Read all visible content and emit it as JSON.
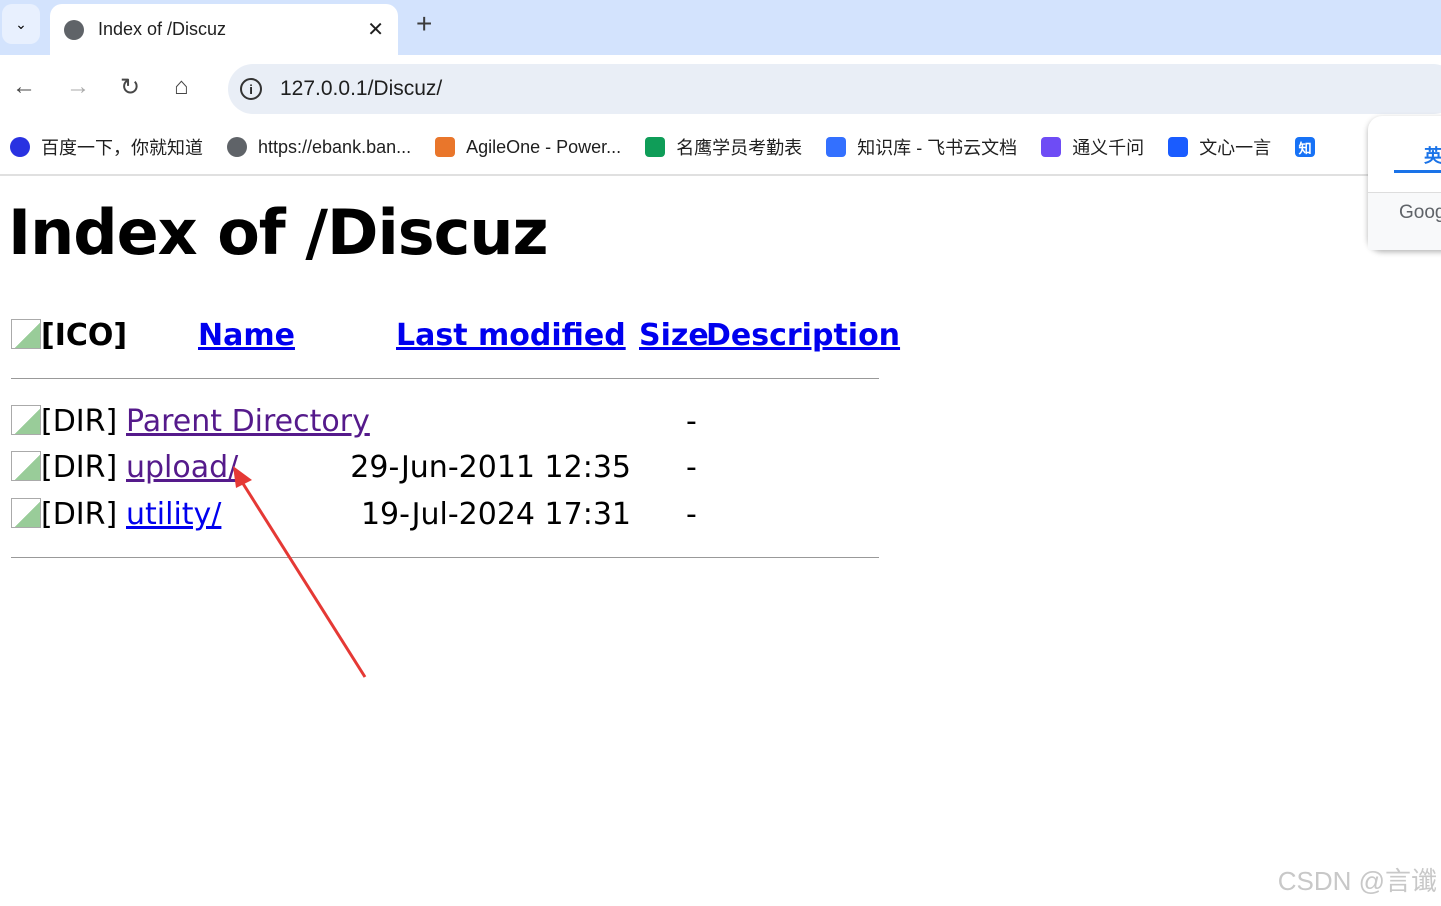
{
  "browser": {
    "tab_title": "Index of /Discuz",
    "url": "127.0.0.1/Discuz/",
    "bookmarks": [
      {
        "label": "百度一下，你就知道",
        "icon": "baidu-icon",
        "color": "#2932e1"
      },
      {
        "label": "https://ebank.ban...",
        "icon": "globe-icon",
        "color": "#5f6368"
      },
      {
        "label": "AgileOne - Power...",
        "icon": "xampp-icon",
        "color": "#e9762b"
      },
      {
        "label": "名鹰学员考勤表",
        "icon": "sheet-icon",
        "color": "#0f9d58"
      },
      {
        "label": "知识库 - 飞书云文档",
        "icon": "feishu-icon",
        "color": "#3370ff"
      },
      {
        "label": "通义千问",
        "icon": "tongyi-icon",
        "color": "#6e4cf5"
      },
      {
        "label": "文心一言",
        "icon": "wenxin-icon",
        "color": "#1a5cff"
      },
      {
        "label": "",
        "icon": "zhihu-icon",
        "color": "#1772f6",
        "glyph": "知"
      }
    ],
    "translate_popup": {
      "lang": "英",
      "provider": "Goog"
    }
  },
  "page": {
    "title": "Index of /Discuz",
    "headers": {
      "ico": "[ICO]",
      "name": "Name",
      "modified": "Last modified",
      "size": "Size",
      "desc": "Description"
    },
    "rows": [
      {
        "type": "[DIR]",
        "name": "Parent Directory",
        "modified": "",
        "size": "-"
      },
      {
        "type": "[DIR]",
        "name": "upload/",
        "modified": "29-Jun-2011 12:35",
        "size": "-"
      },
      {
        "type": "[DIR]",
        "name": "utility/",
        "modified": "19-Jul-2024 17:31",
        "size": "-"
      }
    ]
  },
  "watermark": "CSDN @言谶",
  "colors": {
    "link": "#0000ee",
    "visited": "#551a8b",
    "arrow": "#e53935"
  }
}
